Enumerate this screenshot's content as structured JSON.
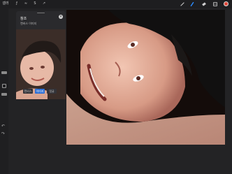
{
  "topbar": {
    "menu": [
      "Gallery",
      "Actions",
      "Adjust",
      "Select",
      "Transform"
    ],
    "menu_short": [
      "갤러",
      "ƒ",
      "≈",
      "S",
      "↗"
    ],
    "tools": [
      "brush-icon",
      "smudge-icon",
      "eraser-icon",
      "layers-icon"
    ],
    "active_color": "#e0483a"
  },
  "reference": {
    "title": "참조",
    "subtitle": "캔버스  이미지",
    "tabs": [
      "캔버스",
      "이미지",
      "얼굴"
    ],
    "active_tab": 1
  },
  "colors": {
    "accent": "#2b6fd6",
    "background": "#232325",
    "canvas_bg": "#140c0a"
  }
}
